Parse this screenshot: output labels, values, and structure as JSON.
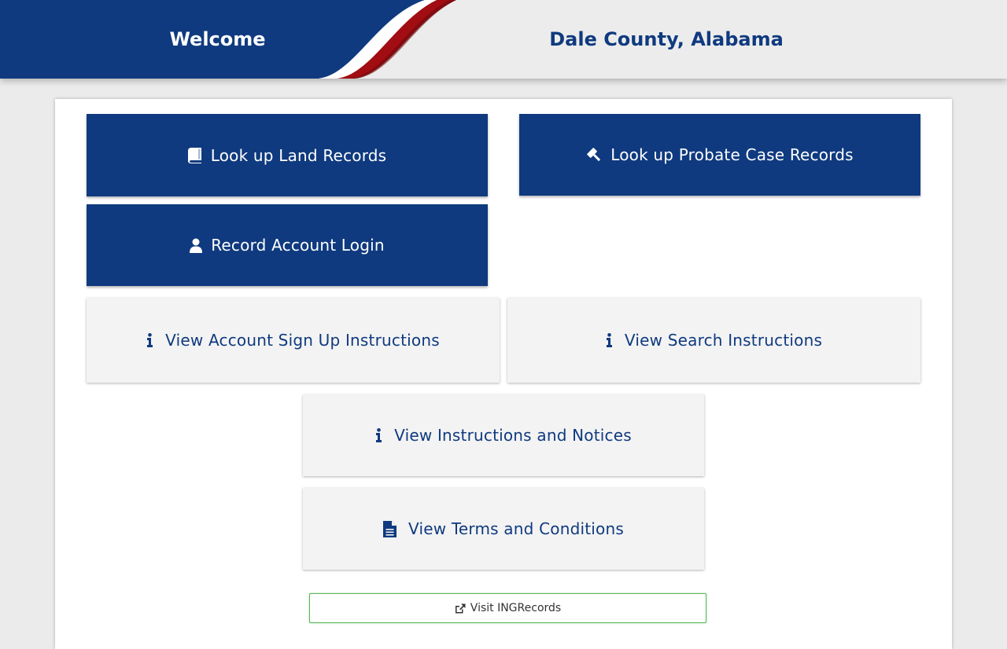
{
  "header": {
    "welcome": "Welcome",
    "county": "Dale County, Alabama",
    "colors": {
      "navy": "#0f3a7f",
      "red": "#a10d12",
      "bar": "#ececec"
    }
  },
  "buttons": {
    "land_records": {
      "label": "Look up Land Records",
      "icon": "book-icon"
    },
    "probate_records": {
      "label": "Look up Probate Case Records",
      "icon": "gavel-icon"
    },
    "account_login": {
      "label": "Record Account Login",
      "icon": "user-icon"
    },
    "signup_instructions": {
      "label": "View Account Sign Up Instructions",
      "icon": "info-icon"
    },
    "search_instructions": {
      "label": "View Search Instructions",
      "icon": "info-icon"
    },
    "instructions_notices": {
      "label": "View Instructions and Notices",
      "icon": "info-icon"
    },
    "terms_conditions": {
      "label": "View Terms and Conditions",
      "icon": "document-icon"
    }
  },
  "visit": {
    "label": "Visit INGRecords",
    "icon": "external-link-icon",
    "border_color": "#5cb85c"
  }
}
